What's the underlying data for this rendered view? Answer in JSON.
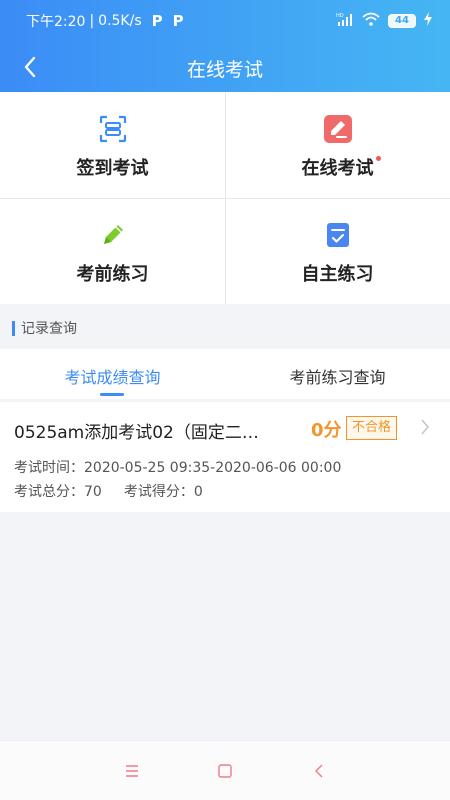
{
  "status_bar": {
    "time": "下午2:20",
    "speed": "0.5K/s",
    "app_icons": [
      "P",
      "P"
    ],
    "hd_label": "HD",
    "battery": "44"
  },
  "nav": {
    "title": "在线考试",
    "back_icon": "chevron-left-icon"
  },
  "grid": [
    {
      "label": "签到考试",
      "icon": "scan-icon",
      "color": "#3b8cf6",
      "has_dot": false
    },
    {
      "label": "在线考试",
      "icon": "edit-icon",
      "color": "#f06a6a",
      "has_dot": true
    },
    {
      "label": "考前练习",
      "icon": "pencil-icon",
      "color": "#7ccc2b",
      "has_dot": false
    },
    {
      "label": "自主练习",
      "icon": "checklist-icon",
      "color": "#4a86f0",
      "has_dot": false
    }
  ],
  "section_title": "记录查询",
  "tabs": [
    {
      "label": "考试成绩查询",
      "active": true
    },
    {
      "label": "考前练习查询",
      "active": false
    }
  ],
  "record": {
    "title": "0525am添加考试02（固定二…",
    "score": "0分",
    "status": "不合格",
    "time_label": "考试时间：",
    "time_value": "2020-05-25 09:35-2020-06-06 00:00",
    "total_label": "考试总分：",
    "total_value": "70",
    "got_label": "考试得分：",
    "got_value": "0"
  },
  "colors": {
    "accent": "#3b8cf6",
    "warning": "#f0962b"
  }
}
